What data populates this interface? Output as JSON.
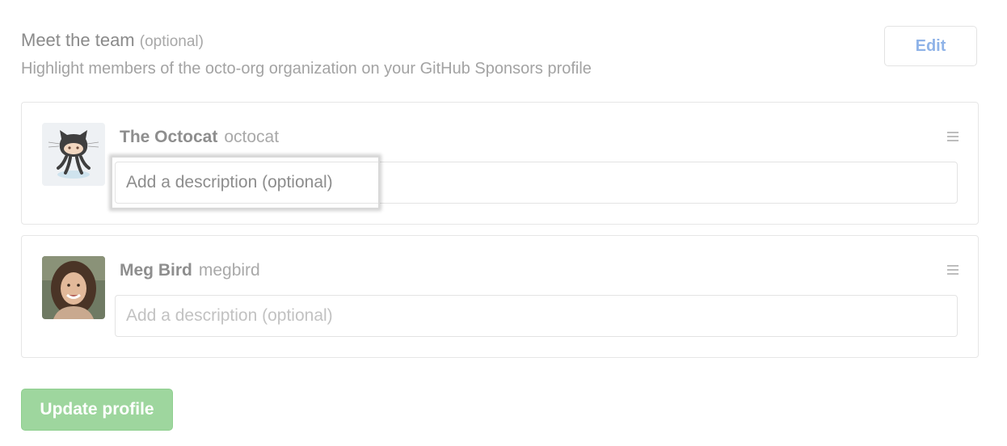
{
  "section": {
    "title": "Meet the team",
    "title_optional": "(optional)",
    "subtitle": "Highlight members of the octo-org organization on your GitHub Sponsors profile"
  },
  "edit_button": {
    "label": "Edit"
  },
  "members": [
    {
      "display_name": "The Octocat",
      "login": "octocat",
      "avatar_icon": "octocat-avatar",
      "description_placeholder": "Add a description (optional)",
      "description_value": "",
      "highlighted": true
    },
    {
      "display_name": "Meg Bird",
      "login": "megbird",
      "avatar_icon": "user-photo-avatar",
      "description_placeholder": "Add a description (optional)",
      "description_value": ""
    }
  ],
  "update_button": {
    "label": "Update profile"
  },
  "colors": {
    "link_blue": "#8fb3e8",
    "success_green": "#9ed69e",
    "border": "#e6e6e6",
    "text_muted": "#a3a3a3"
  }
}
